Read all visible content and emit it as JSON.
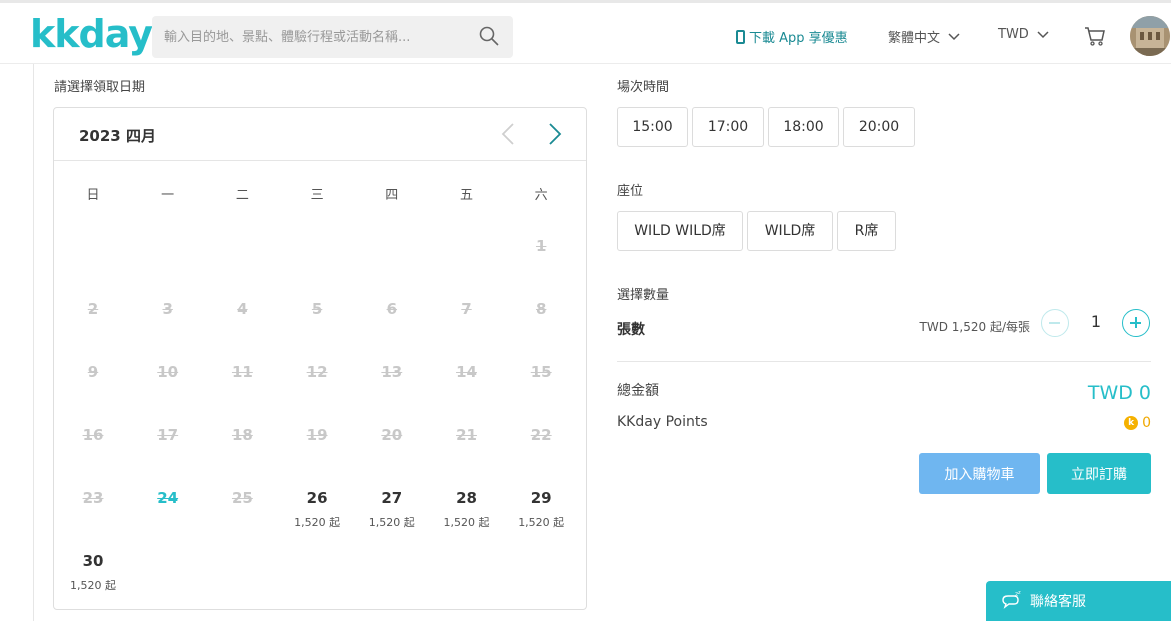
{
  "header": {
    "logo": "kkday",
    "search_placeholder": "輸入目的地、景點、體驗行程或活動名稱...",
    "app_link": "下載 App 享優惠",
    "language": "繁體中文",
    "currency": "TWD"
  },
  "calendar": {
    "label": "請選擇領取日期",
    "month": "2023 四月",
    "weekdays": [
      "日",
      "一",
      "二",
      "三",
      "四",
      "五",
      "六"
    ],
    "days": [
      {
        "n": "1",
        "state": "past",
        "price": ""
      },
      {
        "n": "2",
        "state": "past",
        "price": ""
      },
      {
        "n": "3",
        "state": "past",
        "price": ""
      },
      {
        "n": "4",
        "state": "past",
        "price": ""
      },
      {
        "n": "5",
        "state": "past",
        "price": ""
      },
      {
        "n": "6",
        "state": "past",
        "price": ""
      },
      {
        "n": "7",
        "state": "past",
        "price": ""
      },
      {
        "n": "8",
        "state": "past",
        "price": ""
      },
      {
        "n": "9",
        "state": "past",
        "price": ""
      },
      {
        "n": "10",
        "state": "past",
        "price": ""
      },
      {
        "n": "11",
        "state": "past",
        "price": ""
      },
      {
        "n": "12",
        "state": "past",
        "price": ""
      },
      {
        "n": "13",
        "state": "past",
        "price": ""
      },
      {
        "n": "14",
        "state": "past",
        "price": ""
      },
      {
        "n": "15",
        "state": "past",
        "price": ""
      },
      {
        "n": "16",
        "state": "past",
        "price": ""
      },
      {
        "n": "17",
        "state": "past",
        "price": ""
      },
      {
        "n": "18",
        "state": "past",
        "price": ""
      },
      {
        "n": "19",
        "state": "past",
        "price": ""
      },
      {
        "n": "20",
        "state": "past",
        "price": ""
      },
      {
        "n": "21",
        "state": "past",
        "price": ""
      },
      {
        "n": "22",
        "state": "past",
        "price": ""
      },
      {
        "n": "23",
        "state": "past",
        "price": ""
      },
      {
        "n": "24",
        "state": "today",
        "price": ""
      },
      {
        "n": "25",
        "state": "past",
        "price": ""
      },
      {
        "n": "26",
        "state": "available",
        "price": "1,520 起"
      },
      {
        "n": "27",
        "state": "available",
        "price": "1,520 起"
      },
      {
        "n": "28",
        "state": "available",
        "price": "1,520 起"
      },
      {
        "n": "29",
        "state": "available",
        "price": "1,520 起"
      },
      {
        "n": "30",
        "state": "available",
        "price": "1,520 起"
      }
    ]
  },
  "session": {
    "label": "場次時間",
    "times": [
      "15:00",
      "17:00",
      "18:00",
      "20:00"
    ]
  },
  "seat": {
    "label": "座位",
    "options": [
      "WILD WILD席",
      "WILD席",
      "R席"
    ]
  },
  "quantity": {
    "label": "選擇數量",
    "item_label": "張數",
    "unit_price": "TWD 1,520 起/每張",
    "value": "1"
  },
  "summary": {
    "total_label": "總金額",
    "total_value": "TWD 0",
    "points_label": "KKday Points",
    "points_value": "0",
    "coin_letter": "k"
  },
  "actions": {
    "add_to_cart": "加入購物車",
    "book_now": "立即訂購"
  },
  "support": {
    "label": "聯絡客服"
  },
  "colors": {
    "accent": "#26bec9",
    "cart_button": "#6fb6f0",
    "points": "#f0a800"
  }
}
